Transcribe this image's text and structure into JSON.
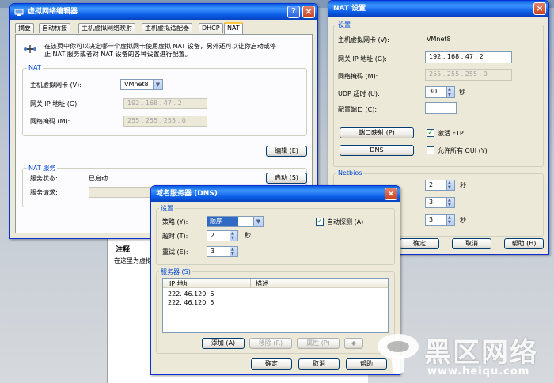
{
  "vnet_editor": {
    "title": "虚拟网络编辑器",
    "tabs": [
      "摘要",
      "自动桥接",
      "主机虚拟网络映射",
      "主机虚拟适配器",
      "DHCP",
      "NAT"
    ],
    "active_tab": "NAT",
    "description": "在该页中你可以决定哪一个虚拟网卡使用虚拟 NAT 设备，另外还可以让你启动或停止 NAT 服务或者对 NAT 设备的各种设置进行配置。",
    "nat_group": "NAT",
    "host_adapter_label": "主机虚拟网卡 (V):",
    "host_adapter_value": "VMnet8",
    "gateway_label": "网关 IP 地址 (G):",
    "gateway_value": "192 . 168 . 47 . 2",
    "netmask_label": "网络掩码 (M):",
    "netmask_value": "255 . 255 . 255 . 0",
    "edit_button": "编辑 (E)",
    "service_group": "NAT 服务",
    "status_label": "服务状态:",
    "status_value": "已启动",
    "start_button": "启动 (S)",
    "request_label": "服务请求:"
  },
  "nat_settings": {
    "title": "NAT 设置",
    "settings_group": "设置",
    "host_adapter_label": "主机虚拟网卡 (V):",
    "host_adapter_value": "VMnet8",
    "gateway_label": "网关 IP 地址 (G):",
    "gateway_value": "192 . 168 . 47 . 2",
    "netmask_label": "网络掩码 (M):",
    "netmask_value": "255 . 255 . 255 . 0",
    "udp_timeout_label": "UDP 超时 (U):",
    "udp_timeout_value": "30",
    "seconds": "秒",
    "config_port_label": "配置端口 (C):",
    "config_port_value": "",
    "port_mapping_button": "端口映射 (P)",
    "dns_button": "DNS",
    "active_ftp_label": "激活 FTP",
    "active_ftp_checked": true,
    "allow_oui_label": "允许所有 OUI (Y)",
    "allow_oui_checked": false,
    "netbios_group": "Netbios",
    "netbios_values": [
      "2",
      "3",
      "3"
    ],
    "ok_button": "确定",
    "cancel_button": "取消",
    "help_button": "帮助 (H)"
  },
  "dns_dialog": {
    "title": "域名服务器 (DNS)",
    "settings_group": "设置",
    "policy_label": "策略 (Y):",
    "policy_value": "顺序",
    "auto_detect_label": "自动探测 (A)",
    "auto_detect_checked": true,
    "timeout_label": "超时 (T):",
    "timeout_value": "2",
    "seconds": "秒",
    "retry_label": "重试 (E):",
    "retry_value": "3",
    "servers_group": "服务器 (S)",
    "columns": [
      "IP 地址",
      "描述"
    ],
    "servers": [
      {
        "ip": "222. 46.120.  6",
        "desc": ""
      },
      {
        "ip": "222. 46.120.  5",
        "desc": ""
      }
    ],
    "add_button": "添加 (A)",
    "remove_button": "移除 (R)",
    "properties_button": "属性 (P)",
    "ok_button": "确定",
    "cancel_button": "取消",
    "help_button": "帮助"
  },
  "background": {
    "note_title": "注释",
    "note_text": "在这里为虚拟"
  },
  "watermark": {
    "name": "黑区网络",
    "url": "www.heiqu.com"
  }
}
